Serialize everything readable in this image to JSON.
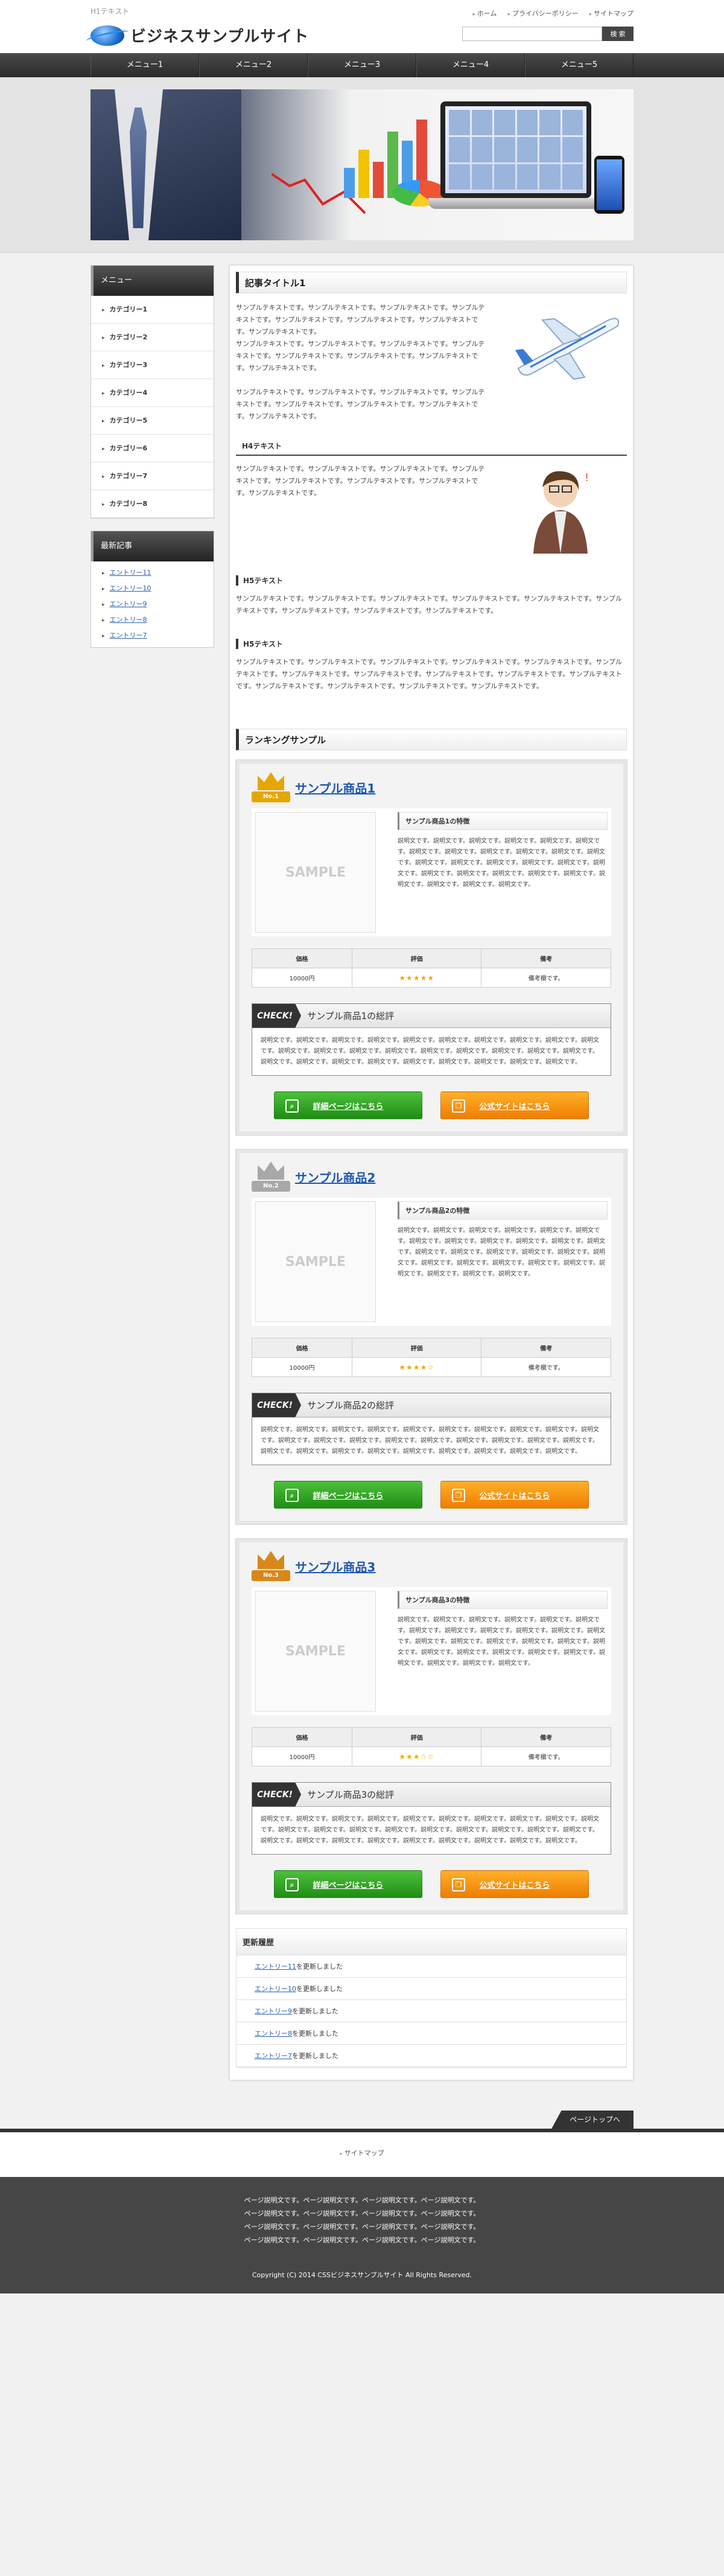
{
  "header": {
    "h1_text": "H1テキスト",
    "site_title": "ビジネスサンプルサイト",
    "top_links": [
      "ホーム",
      "プライバシーポリシー",
      "サイトマップ"
    ],
    "search_placeholder": "",
    "search_button": "検 索"
  },
  "gnav": [
    "メニュー1",
    "メニュー2",
    "メニュー3",
    "メニュー4",
    "メニュー5"
  ],
  "sidebar": {
    "menu_title": "メニュー",
    "categories": [
      "カテゴリー1",
      "カテゴリー2",
      "カテゴリー3",
      "カテゴリー4",
      "カテゴリー5",
      "カテゴリー6",
      "カテゴリー7",
      "カテゴリー8"
    ],
    "new_title": "最新記事",
    "new_entries": [
      "エントリー11",
      "エントリー10",
      "エントリー9",
      "エントリー8",
      "エントリー7"
    ]
  },
  "article": {
    "h2": "記事タイトル1",
    "p1": "サンプルテキストです。サンプルテキストです。サンプルテキストです。サンプルテキストです。サンプルテキストです。サンプルテキストです。サンプルテキストです。サンプルテキストです。",
    "p2": "サンプルテキストです。サンプルテキストです。サンプルテキストです。サンプルテキストです。サンプルテキストです。サンプルテキストです。サンプルテキストです。サンプルテキストです。",
    "p3": "サンプルテキストです。サンプルテキストです。サンプルテキストです。サンプルテキストです。サンプルテキストです。サンプルテキストです。サンプルテキストです。サンプルテキストです。",
    "h4": "H4テキスト",
    "p4": "サンプルテキストです。サンプルテキストです。サンプルテキストです。サンプルテキストです。サンプルテキストです。サンプルテキストです。サンプルテキストです。サンプルテキストです。",
    "h5a": "H5テキスト",
    "p5": "サンプルテキストです。サンプルテキストです。サンプルテキストです。サンプルテキストです。サンプルテキストです。サンプルテキストです。サンプルテキストです。サンプルテキストです。サンプルテキストです。",
    "h5b": "H5テキスト",
    "p6": "サンプルテキストです。サンプルテキストです。サンプルテキストです。サンプルテキストです。サンプルテキストです。サンプルテキストです。サンプルテキストです。サンプルテキストです。サンプルテキストです。サンプルテキストです。サンプルテキストです。サンプルテキストです。サンプルテキストです。サンプルテキストです。サンプルテキストです。"
  },
  "ranking": {
    "h2": "ランキングサンプル",
    "sample_label": "SAMPLE",
    "th": [
      "価格",
      "評価",
      "備考"
    ],
    "check": "CHECK!",
    "btn_detail": "詳細ページはこちら",
    "btn_official": "公式サイトはこちら",
    "items": [
      {
        "badge": "No.1",
        "name": "サンプル商品1",
        "feat_title": "サンプル商品1の特徴",
        "feat": "説明文です。説明文です。説明文です。説明文です。説明文です。説明文です。説明文です。説明文です。説明文です。説明文です。説明文です。説明文です。説明文です。説明文です。説明文です。説明文です。説明文です。説明文です。説明文です。説明文です。説明文です。説明文です。説明文です。説明文です。説明文です。説明文です。説明文です。",
        "price": "10000円",
        "stars": "★★★★★",
        "rating": 5,
        "note": "備考欄です。",
        "review_title": "サンプル商品1の総評",
        "review": "説明文です。説明文です。説明文です。説明文です。説明文です。説明文です。説明文です。説明文です。説明文です。説明文です。説明文です。説明文です。説明文です。説明文です。説明文です。説明文です。説明文です。説明文です。説明文です。説明文です。説明文です。説明文です。説明文です。説明文です。説明文です。説明文です。説明文です。説明文です。",
        "color": "#e6a600"
      },
      {
        "badge": "No.2",
        "name": "サンプル商品2",
        "feat_title": "サンプル商品2の特徴",
        "feat": "説明文です。説明文です。説明文です。説明文です。説明文です。説明文です。説明文です。説明文です。説明文です。説明文です。説明文です。説明文です。説明文です。説明文です。説明文です。説明文です。説明文です。説明文です。説明文です。説明文です。説明文です。説明文です。説明文です。説明文です。説明文です。説明文です。説明文です。",
        "price": "10000円",
        "stars": "★★★★☆",
        "rating": 4,
        "note": "備考欄です。",
        "review_title": "サンプル商品2の総評",
        "review": "説明文です。説明文です。説明文です。説明文です。説明文です。説明文です。説明文です。説明文です。説明文です。説明文です。説明文です。説明文です。説明文です。説明文です。説明文です。説明文です。説明文です。説明文です。説明文です。説明文です。説明文です。説明文です。説明文です。説明文です。説明文です。説明文です。説明文です。説明文です。",
        "color": "#a8a8a8"
      },
      {
        "badge": "No.3",
        "name": "サンプル商品3",
        "feat_title": "サンプル商品3の特徴",
        "feat": "説明文です。説明文です。説明文です。説明文です。説明文です。説明文です。説明文です。説明文です。説明文です。説明文です。説明文です。説明文です。説明文です。説明文です。説明文です。説明文です。説明文です。説明文です。説明文です。説明文です。説明文です。説明文です。説明文です。説明文です。説明文です。説明文です。説明文です。",
        "price": "10000円",
        "stars": "★★★☆☆",
        "rating": 3,
        "note": "備考欄です。",
        "review_title": "サンプル商品3の総評",
        "review": "説明文です。説明文です。説明文です。説明文です。説明文です。説明文です。説明文です。説明文です。説明文です。説明文です。説明文です。説明文です。説明文です。説明文です。説明文です。説明文です。説明文です。説明文です。説明文です。説明文です。説明文です。説明文です。説明文です。説明文です。説明文です。説明文です。説明文です。説明文です。",
        "color": "#d9861a"
      }
    ]
  },
  "updates": {
    "title": "更新履歴",
    "items": [
      {
        "link": "エントリー11",
        "text": "を更新しました"
      },
      {
        "link": "エントリー10",
        "text": "を更新しました"
      },
      {
        "link": "エントリー9",
        "text": "を更新しました"
      },
      {
        "link": "エントリー8",
        "text": "を更新しました"
      },
      {
        "link": "エントリー7",
        "text": "を更新しました"
      }
    ]
  },
  "footer": {
    "pagetop": "ページトップへ",
    "sitemap": "サイトマップ",
    "desc": [
      "ページ説明文です。ページ説明文です。ページ説明文です。ページ説明文です。",
      "ページ説明文です。ページ説明文です。ページ説明文です。ページ説明文です。",
      "ページ説明文です。ページ説明文です。ページ説明文です。ページ説明文です。",
      "ページ説明文です。ページ説明文です。ページ説明文です。ページ説明文です。"
    ],
    "copyright": "Copyright (C) 2014 CSSビジネスサンプルサイト All Rights Reserved."
  },
  "colors": {
    "accent_link": "#1e57b0",
    "btn_green": "#1f8c14",
    "btn_orange": "#ee7d00",
    "nav_dark": "#2a2a2a"
  }
}
